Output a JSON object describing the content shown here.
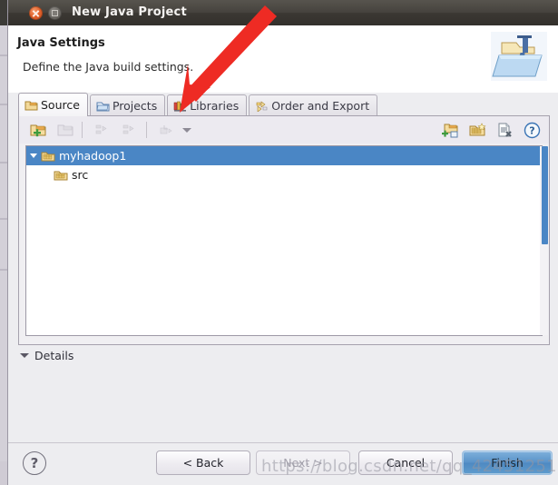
{
  "window": {
    "title": "New Java Project",
    "close_icon": "close-icon",
    "maximize_icon": "maximize-icon"
  },
  "header": {
    "title": "Java Settings",
    "subtitle": "Define the Java build settings.",
    "banner_icon": "java-project-folder-icon"
  },
  "tabs": [
    {
      "label": "Source",
      "icon": "source-folder-icon",
      "active": true
    },
    {
      "label": "Projects",
      "icon": "projects-folder-icon",
      "active": false
    },
    {
      "label": "Libraries",
      "icon": "libraries-books-icon",
      "active": false
    },
    {
      "label": "Order and Export",
      "icon": "order-export-icon",
      "active": false
    }
  ],
  "toolbar": {
    "left_icons": [
      {
        "name": "add-folder-icon",
        "enabled": true
      },
      {
        "name": "add-source-folder-icon",
        "enabled": false
      },
      {
        "name": "link-source-icon",
        "enabled": false
      },
      {
        "name": "add-external-icon",
        "enabled": false
      },
      {
        "name": "filter-icon",
        "enabled": false
      }
    ],
    "dropdown_icon": "chevron-down-icon",
    "right_icons": [
      {
        "name": "add-folder-green-icon",
        "enabled": true
      },
      {
        "name": "link-source-star-icon",
        "enabled": true
      },
      {
        "name": "remove-source-icon",
        "enabled": true
      },
      {
        "name": "help-circle-icon",
        "enabled": true
      }
    ]
  },
  "tree": {
    "nodes": [
      {
        "label": "myhadoop1",
        "icon": "project-folder-icon",
        "selected": true,
        "expanded": true,
        "depth": 0
      },
      {
        "label": "src",
        "icon": "source-folder-icon",
        "selected": false,
        "expanded": false,
        "depth": 1
      }
    ]
  },
  "details": {
    "label": "Details",
    "expander_icon": "triangle-down-icon",
    "expanded": true
  },
  "footer": {
    "help_icon": "question-mark-icon",
    "buttons": [
      {
        "label": "< Back",
        "enabled": true,
        "primary": false
      },
      {
        "label": "Next >",
        "enabled": false,
        "primary": false
      },
      {
        "label": "Cancel",
        "enabled": true,
        "primary": false
      },
      {
        "label": "Finish",
        "enabled": true,
        "primary": true
      }
    ]
  },
  "annotation": {
    "arrow_color": "#ee2b24",
    "points_to": "Libraries"
  },
  "watermark": {
    "text": "https://blog.csdn.net/qq_42451251"
  },
  "colors": {
    "selection_blue": "#4a86c5",
    "finish_blue": "#5a93c9",
    "titlebar_dark": "#3b3833",
    "panel_grey": "#ededf0",
    "annotation_red": "#ee2b24"
  }
}
